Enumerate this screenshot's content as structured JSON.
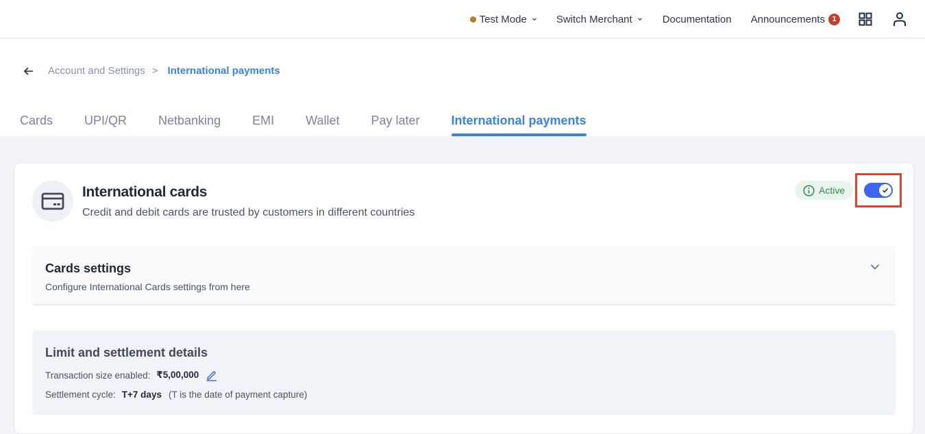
{
  "topnav": {
    "test_mode": "Test Mode",
    "test_mode_color": "#b67a2c",
    "switch_merchant": "Switch Merchant",
    "documentation": "Documentation",
    "announcements": "Announcements",
    "announcements_count": "1",
    "apps_icon": "grid-icon",
    "profile_icon": "user-icon"
  },
  "breadcrumb": {
    "back_icon": "arrow-left-icon",
    "parent": "Account and Settings",
    "separator": ">",
    "current": "International payments"
  },
  "tabs": [
    {
      "label": "Cards",
      "active": false
    },
    {
      "label": "UPI/QR",
      "active": false
    },
    {
      "label": "Netbanking",
      "active": false
    },
    {
      "label": "EMI",
      "active": false
    },
    {
      "label": "Wallet",
      "active": false
    },
    {
      "label": "Pay later",
      "active": false
    },
    {
      "label": "International payments",
      "active": true
    }
  ],
  "card": {
    "icon": "credit-card-icon",
    "title": "International cards",
    "description": "Credit and debit cards are trusted by customers in different countries",
    "status": "Active",
    "status_color": "#2e8b4e",
    "toggle_on": true,
    "accent_color": "#3d63ef"
  },
  "settings": {
    "title": "Cards settings",
    "description": "Configure International Cards settings from here",
    "expanded": false
  },
  "limits": {
    "title": "Limit and settlement details",
    "transaction_label": "Transaction size enabled:",
    "transaction_value": "₹5,00,000",
    "settlement_label": "Settlement cycle:",
    "settlement_value": "T+7 days",
    "settlement_note": "(T is the date of payment capture)"
  }
}
